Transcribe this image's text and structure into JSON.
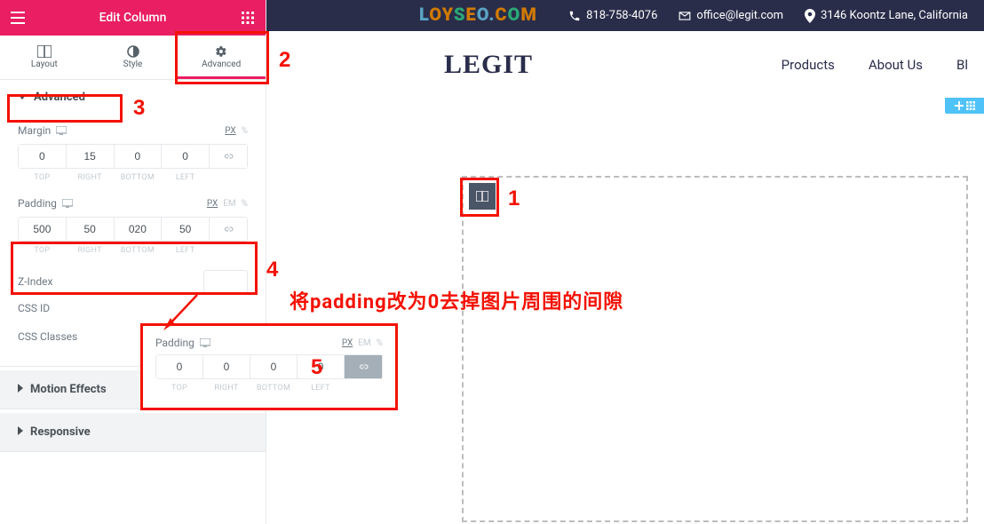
{
  "panel": {
    "title": "Edit Column",
    "tabs": {
      "layout": "Layout",
      "style": "Style",
      "advanced": "Advanced"
    },
    "sections": {
      "advanced": "Advanced",
      "motion": "Motion Effects",
      "responsive": "Responsive"
    },
    "controls": {
      "margin": {
        "label": "Margin",
        "units_active": "PX",
        "units_other": "%",
        "top": "0",
        "right": "15",
        "bottom": "0",
        "left": "0",
        "top_l": "TOP",
        "right_l": "RIGHT",
        "bottom_l": "BOTTOM",
        "left_l": "LEFT"
      },
      "padding": {
        "label": "Padding",
        "units_active": "PX",
        "units_em": "EM",
        "units_pct": "%",
        "top": "500",
        "right": "50",
        "bottom": "020",
        "left": "50",
        "top_l": "TOP",
        "right_l": "RIGHT",
        "bottom_l": "BOTTOM",
        "left_l": "LEFT"
      },
      "zindex": {
        "label": "Z-Index",
        "value": ""
      },
      "cssid": {
        "label": "CSS ID",
        "value": ""
      },
      "cssclasses": {
        "label": "CSS Classes",
        "value": ""
      }
    }
  },
  "preview": {
    "topbar": {
      "phone": "818-758-4076",
      "email": "office@legit.com",
      "address": "3146 Koontz Lane, California"
    },
    "brand": "LEGIT",
    "nav": {
      "products": "Products",
      "about": "About Us",
      "blog": "Bl"
    }
  },
  "float_padding": {
    "label": "Padding",
    "units_active": "PX",
    "units_em": "EM",
    "units_pct": "%",
    "top": "0",
    "right": "0",
    "bottom": "0",
    "left": "0",
    "top_l": "TOP",
    "right_l": "RIGHT",
    "bottom_l": "BOTTOM",
    "left_l": "LEFT"
  },
  "annotations": {
    "n1": "1",
    "n2": "2",
    "n3": "3",
    "n4": "4",
    "n5": "5",
    "hint": "将padding改为0去掉图片周围的间隙"
  },
  "watermark": {
    "a": "L",
    "b": "O",
    "c": "Y",
    "d": "S",
    "e": "E",
    "f": "O.",
    "g": "C",
    "h": "O",
    "i": "M"
  }
}
